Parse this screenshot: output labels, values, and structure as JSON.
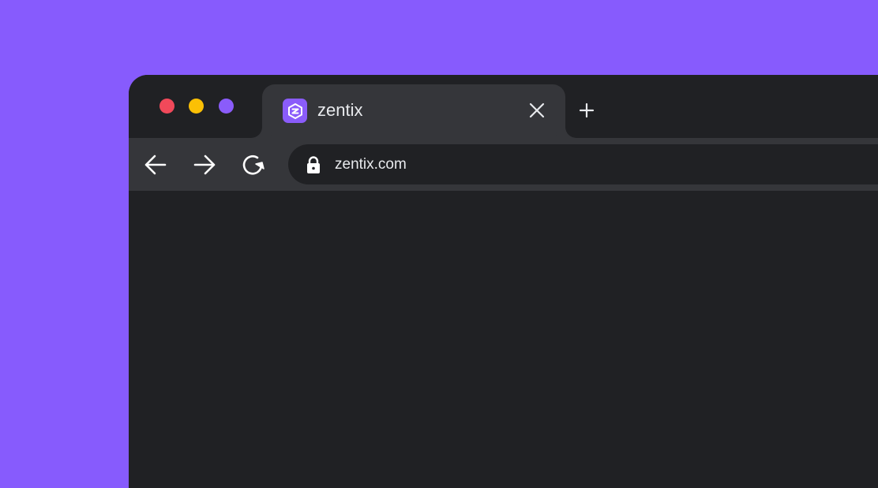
{
  "colors": {
    "background": "#875bfd",
    "window_controls": {
      "close": "#f1495a",
      "minimize": "#fbc005",
      "maximize": "#8a5cfa"
    },
    "favicon": "#8a5cfa"
  },
  "tab": {
    "favicon_icon": "zentix-logo-icon",
    "title": "zentix",
    "close_icon": "close-icon"
  },
  "new_tab_icon": "plus-icon",
  "toolbar": {
    "back_icon": "arrow-left-icon",
    "forward_icon": "arrow-right-icon",
    "reload_icon": "reload-icon"
  },
  "address_bar": {
    "lock_icon": "lock-icon",
    "url": "zentix.com"
  }
}
